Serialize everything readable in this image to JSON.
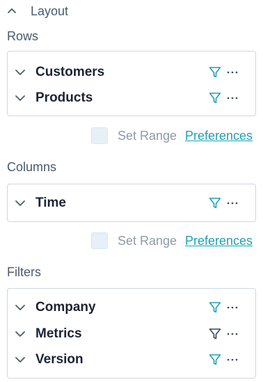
{
  "header": {
    "title": "Layout",
    "collapse_icon": "chevron-up-icon"
  },
  "rows_section": {
    "label": "Rows",
    "items": [
      {
        "label": "Customers",
        "filter_color": "#1fa1b5"
      },
      {
        "label": "Products",
        "filter_color": "#1fa1b5"
      }
    ]
  },
  "rows_options": {
    "set_range": "Set Range",
    "preferences": "Preferences"
  },
  "columns_section": {
    "label": "Columns",
    "items": [
      {
        "label": "Time",
        "filter_color": "#1fa1b5"
      }
    ]
  },
  "columns_options": {
    "set_range": "Set Range",
    "preferences": "Preferences"
  },
  "filters_section": {
    "label": "Filters",
    "items": [
      {
        "label": "Company",
        "filter_color": "#1fa1b5"
      },
      {
        "label": "Metrics",
        "filter_color": "#3a4658"
      },
      {
        "label": "Version",
        "filter_color": "#1fa1b5"
      }
    ]
  },
  "colors": {
    "accent": "#1fa1b5",
    "muted_text": "#8e9aa8",
    "checkbox_bg": "#e7eff7"
  }
}
